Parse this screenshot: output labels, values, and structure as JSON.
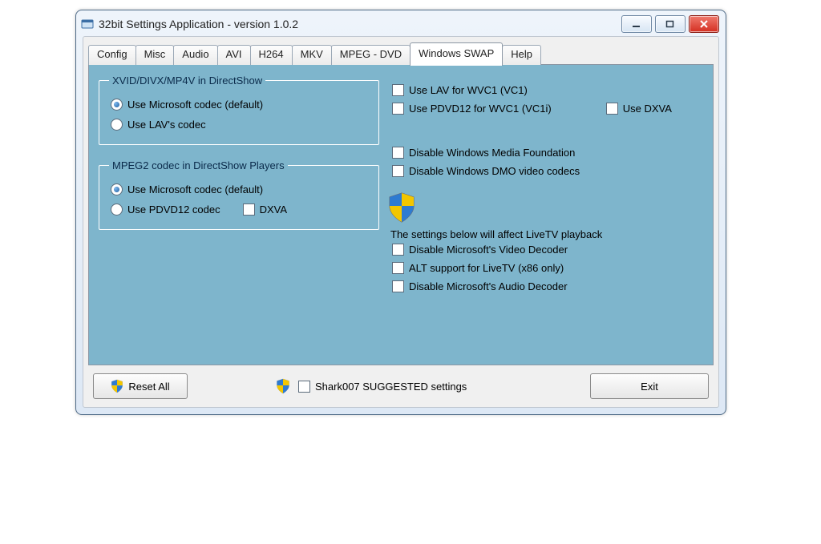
{
  "window": {
    "title": "32bit Settings Application - version 1.0.2"
  },
  "tabs": [
    "Config",
    "Misc",
    "Audio",
    "AVI",
    "H264",
    "MKV",
    "MPEG - DVD",
    "Windows SWAP",
    "Help"
  ],
  "groups": {
    "xvid": {
      "legend": "XVID/DIVX/MP4V in DirectShow",
      "opt_ms": "Use Microsoft codec (default)",
      "opt_lav": "Use LAV's codec"
    },
    "mpeg2": {
      "legend": "MPEG2 codec in DirectShow Players",
      "opt_ms": "Use Microsoft codec (default)",
      "opt_pdvd": "Use PDVD12 codec",
      "dxva": "DXVA"
    }
  },
  "right": {
    "lav_vc1": "Use LAV for WVC1 (VC1)",
    "pdvd_vc1i": "Use PDVD12 for WVC1 (VC1i)",
    "use_dxva": "Use DXVA",
    "disable_wmf": "Disable Windows Media Foundation",
    "disable_dmo": "Disable Windows DMO video codecs",
    "live_label": "The settings below will affect LiveTV playback",
    "disable_ms_vdec": "Disable Microsoft's Video Decoder",
    "alt_livetv": "ALT support for LiveTV (x86 only)",
    "disable_ms_adec": "Disable Microsoft's Audio Decoder"
  },
  "bottom": {
    "reset": "Reset All",
    "suggested": "Shark007 SUGGESTED settings",
    "exit": "Exit"
  }
}
